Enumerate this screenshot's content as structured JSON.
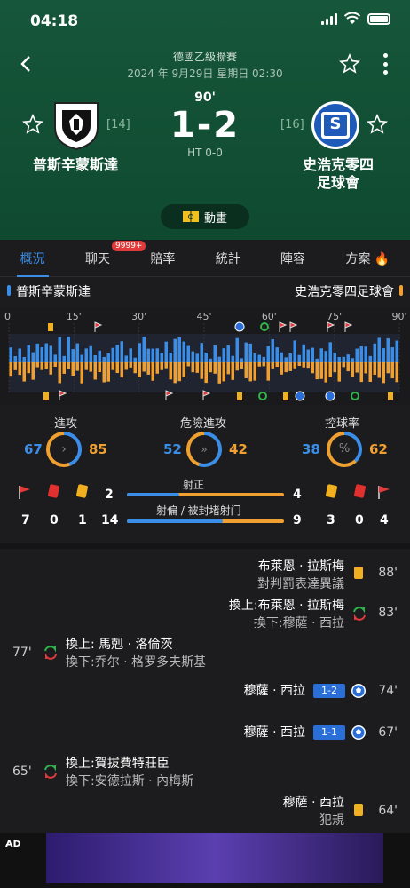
{
  "status": {
    "time": "04:18"
  },
  "match": {
    "league": "德國乙級聯賽",
    "datetime": "2024 年 9月29日 星期日 02:30",
    "minute": "90'",
    "score": "1-2",
    "halftime": "HT 0-0",
    "animation_label": "動畫"
  },
  "home": {
    "name": "普斯辛蒙斯達",
    "rank": "[14]",
    "color": "#3b8ee8"
  },
  "away": {
    "name_line1": "史浩克零四",
    "name_line2": "足球會",
    "rank": "[16]",
    "fullname": "史浩克零四足球會",
    "color": "#f0a030"
  },
  "tabs": [
    {
      "label": "概況"
    },
    {
      "label": "聊天",
      "badge": "9999+"
    },
    {
      "label": "賠率"
    },
    {
      "label": "統計"
    },
    {
      "label": "陣容"
    },
    {
      "label": "方案"
    }
  ],
  "timeline": {
    "ticks": [
      "0'",
      "15'",
      "30'",
      "45'",
      "60'",
      "75'",
      "90'"
    ]
  },
  "stats": {
    "attack": {
      "label": "進攻",
      "home": "67",
      "away": "85"
    },
    "danger": {
      "label": "危險進攻",
      "home": "52",
      "away": "42"
    },
    "possession": {
      "label": "控球率",
      "home": "38",
      "away": "62"
    },
    "on_target": {
      "label": "射正",
      "home": "2",
      "away": "4"
    },
    "off_target": {
      "label": "射偏 / 被封堵射门",
      "home": "14",
      "away": "9"
    },
    "home_corners": "7",
    "home_red": "0",
    "home_yellow": "1",
    "away_yellow": "3",
    "away_red": "0",
    "away_corners": "4"
  },
  "events": [
    {
      "minute": "88'",
      "line1": "布萊恩 · 拉斯梅",
      "line2": "對判罰表達異議"
    },
    {
      "minute": "83'",
      "line1": "換上:布萊恩 · 拉斯梅",
      "line2": "換下:穆薩 · 西拉"
    },
    {
      "minute": "77'",
      "line1": "換上: 馬剋 · 洛倫茨",
      "line2": "換下:乔尔 · 格罗多夫斯基"
    },
    {
      "minute": "74'",
      "line1": "穆薩 · 西拉",
      "score": "1-2"
    },
    {
      "minute": "67'",
      "line1": "穆薩 · 西拉",
      "score": "1-1"
    },
    {
      "minute": "65'",
      "line1": "換上:賀拔費特莊臣",
      "line2": "換下:安德拉斯 · 內梅斯"
    },
    {
      "minute": "64'",
      "line1": "穆薩 · 西拉",
      "line2": "犯規"
    }
  ],
  "ad": {
    "label": "AD"
  }
}
